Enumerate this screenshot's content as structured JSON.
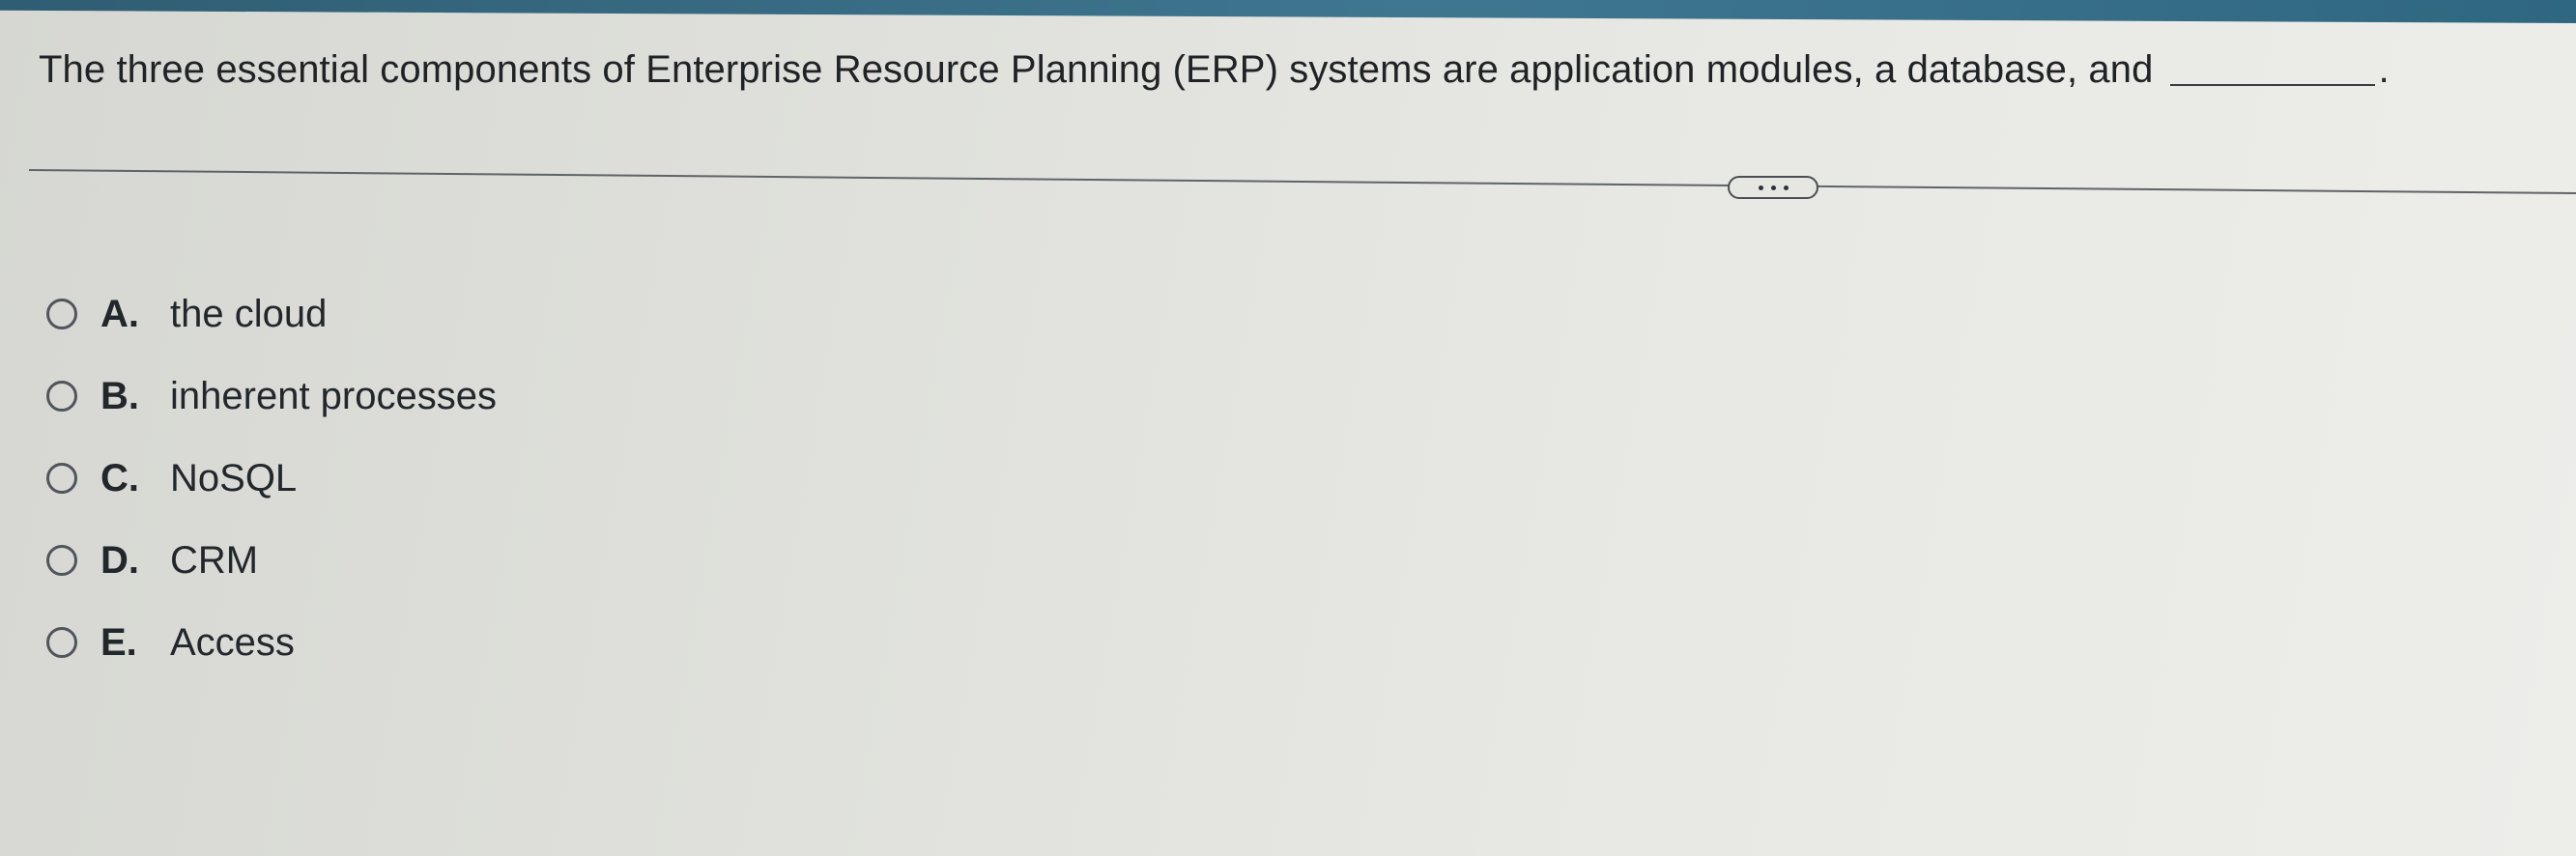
{
  "question": {
    "text": "The three essential components of Enterprise Resource Planning (ERP) systems are application modules, a database, and",
    "period": "."
  },
  "more_button": {
    "icon": "ellipsis-icon"
  },
  "options": [
    {
      "letter": "A.",
      "text": "the cloud"
    },
    {
      "letter": "B.",
      "text": "inherent processes"
    },
    {
      "letter": "C.",
      "text": "NoSQL"
    },
    {
      "letter": "D.",
      "text": "CRM"
    },
    {
      "letter": "E.",
      "text": "Access"
    }
  ]
}
